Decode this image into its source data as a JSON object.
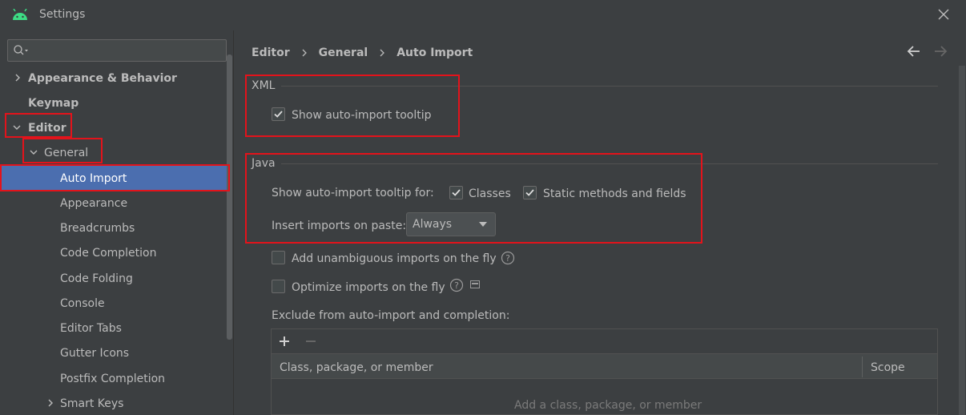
{
  "window": {
    "title": "Settings",
    "app_icon": "android-icon",
    "close_icon": "close-icon"
  },
  "search": {
    "value": "",
    "placeholder": "",
    "icon": "search-icon"
  },
  "sidebar": {
    "items": [
      {
        "label": "Appearance & Behavior",
        "expanded": false
      },
      {
        "label": "Keymap"
      },
      {
        "label": "Editor",
        "expanded": true
      },
      {
        "label": "General",
        "expanded": true
      },
      {
        "label": "Auto Import",
        "selected": true
      },
      {
        "label": "Appearance"
      },
      {
        "label": "Breadcrumbs"
      },
      {
        "label": "Code Completion"
      },
      {
        "label": "Code Folding"
      },
      {
        "label": "Console"
      },
      {
        "label": "Editor Tabs"
      },
      {
        "label": "Gutter Icons"
      },
      {
        "label": "Postfix Completion"
      },
      {
        "label": "Smart Keys",
        "expanded": false
      }
    ]
  },
  "breadcrumb": [
    "Editor",
    "General",
    "Auto Import"
  ],
  "xml_section": {
    "title": "XML",
    "show_tooltip_label": "Show auto-import tooltip",
    "show_tooltip_checked": true
  },
  "java_section": {
    "title": "Java",
    "tooltip_for_label": "Show auto-import tooltip for:",
    "classes_label": "Classes",
    "classes_checked": true,
    "static_label": "Static methods and fields",
    "static_checked": true,
    "insert_label": "Insert imports on paste:",
    "insert_value": "Always",
    "unambiguous_label": "Add unambiguous imports on the fly",
    "unambiguous_checked": false,
    "optimize_label": "Optimize imports on the fly",
    "optimize_checked": false,
    "exclude_label": "Exclude from auto-import and completion:"
  },
  "exclude_table": {
    "columns": [
      "Class, package, or member",
      "Scope"
    ],
    "empty_text": "Add a class, package, or member"
  },
  "colors": {
    "background": "#3c3f41",
    "selection": "#4b6eaf",
    "highlight": "#e3131b",
    "text": "#bbbbbb",
    "android_green": "#3ddc84"
  }
}
